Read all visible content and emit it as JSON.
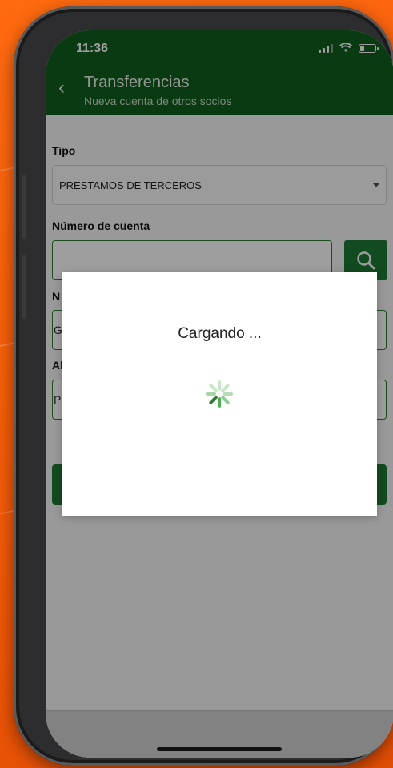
{
  "status_bar": {
    "time": "11:36"
  },
  "header": {
    "title": "Transferencias",
    "subtitle": "Nueva cuenta de otros socios"
  },
  "form": {
    "tipo_label": "Tipo",
    "tipo_value": "PRESTAMOS DE TERCEROS",
    "cuenta_label": "Número de cuenta",
    "cuenta_value": "",
    "nombre_label_visible": "N",
    "nombre_value_visible": "G",
    "alias_label_visible": "Al",
    "alias_value_visible": "Pl"
  },
  "dialog": {
    "text": "Cargando ..."
  },
  "colors": {
    "header_green": "#0f5e1e",
    "accent_green": "#1f7a35",
    "background_orange": "#f25a08"
  },
  "icons": [
    "back-arrow-icon",
    "signal-icon",
    "wifi-icon",
    "battery-icon",
    "dropdown-caret-icon",
    "search-icon",
    "loading-spinner-icon"
  ]
}
